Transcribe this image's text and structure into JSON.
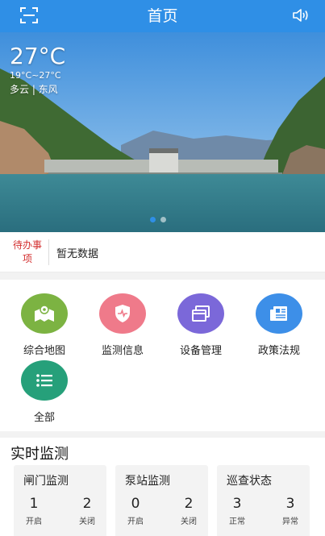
{
  "header": {
    "title": "首页",
    "scan_icon": "scan-icon",
    "speaker_icon": "speaker-icon",
    "color": "#2f8fe6"
  },
  "banner": {
    "temperature": "27°C",
    "range": "19°C~27°C",
    "condition": "多云 | 东风",
    "slide_count": 2,
    "active_slide": 1
  },
  "todo": {
    "tag": "待办事项",
    "message": "暂无数据"
  },
  "shortcuts": [
    {
      "label": "综合地图",
      "icon": "map-icon",
      "color": "#7cb342"
    },
    {
      "label": "监测信息",
      "icon": "shield-pulse-icon",
      "color": "#ef7a8a"
    },
    {
      "label": "设备管理",
      "icon": "windows-icon",
      "color": "#7b68d9"
    },
    {
      "label": "政策法规",
      "icon": "newspaper-icon",
      "color": "#3d8fe8"
    },
    {
      "label": "全部",
      "icon": "list-icon",
      "color": "#26a07a"
    }
  ],
  "realtime": {
    "title": "实时监测",
    "cards": [
      {
        "title": "闸门监测",
        "stats": [
          {
            "value": "1",
            "label": "开启"
          },
          {
            "value": "2",
            "label": "关闭"
          }
        ]
      },
      {
        "title": "泵站监测",
        "stats": [
          {
            "value": "0",
            "label": "开启"
          },
          {
            "value": "2",
            "label": "关闭"
          }
        ]
      },
      {
        "title": "巡查状态",
        "stats": [
          {
            "value": "3",
            "label": "正常"
          },
          {
            "value": "3",
            "label": "异常"
          }
        ]
      }
    ]
  }
}
